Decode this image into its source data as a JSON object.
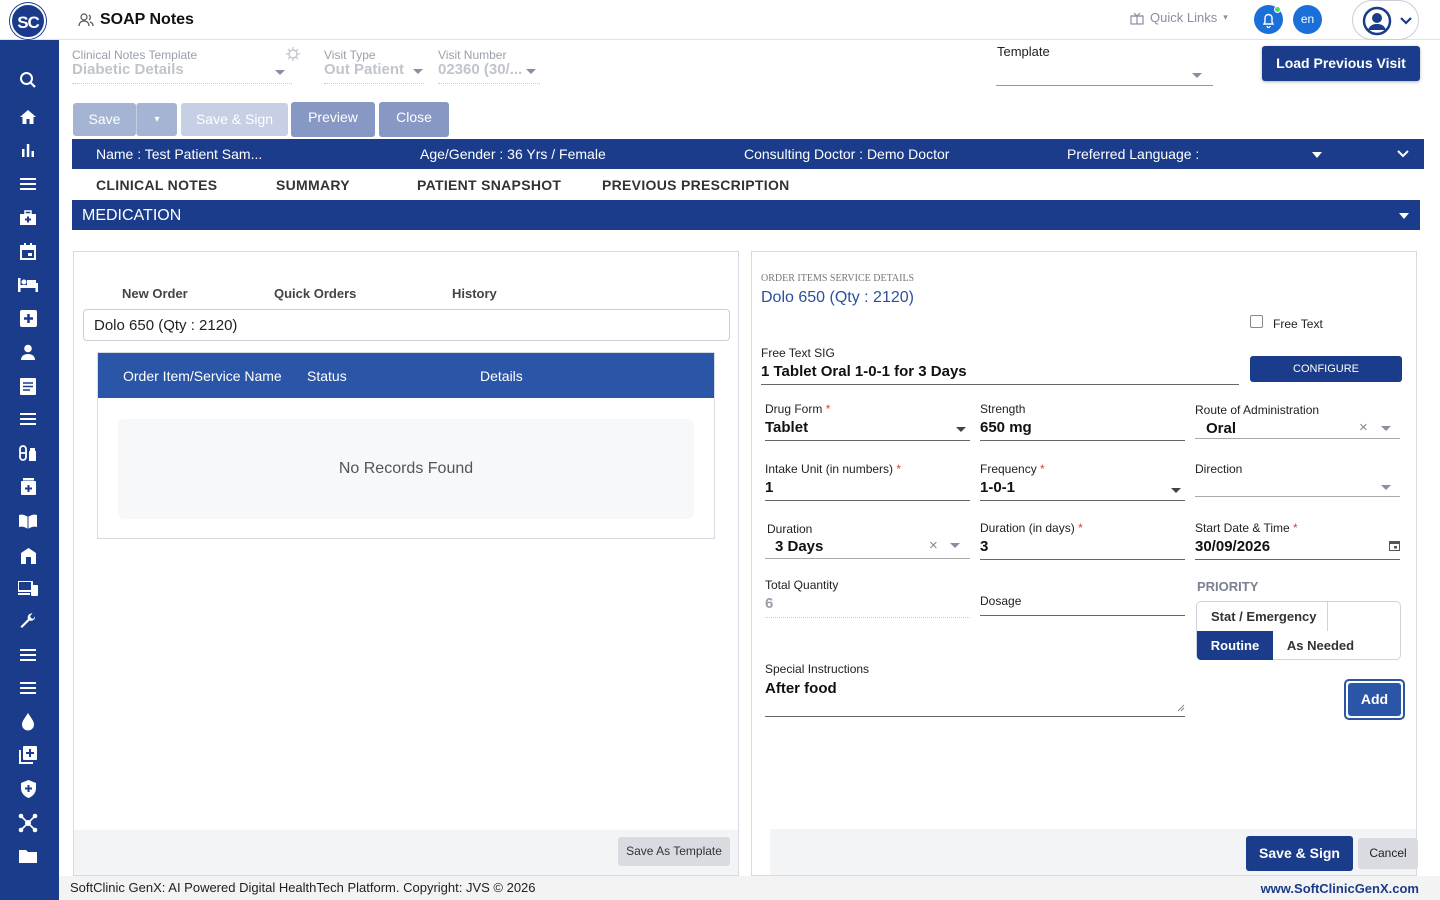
{
  "app": {
    "logo": "SC",
    "title": "SOAP Notes"
  },
  "topbar": {
    "quick_links": "Quick Links",
    "lang": "en"
  },
  "sidebar": {
    "icons": [
      "search-icon",
      "home-icon",
      "bar-chart-icon",
      "menu-icon",
      "clinic-icon",
      "calendar-icon",
      "bed-icon",
      "first-aid-icon",
      "person-icon",
      "document-icon",
      "list-icon",
      "pharmacy-icon",
      "medicine-icon",
      "book-icon",
      "building-icon",
      "devices-icon",
      "wrench-icon",
      "list-icon",
      "list-icon",
      "drop-icon",
      "add-box-icon",
      "shield-icon",
      "network-icon",
      "folder-icon"
    ]
  },
  "header": {
    "clinical_template_label": "Clinical Notes Template",
    "clinical_template_value": "Diabetic Details",
    "visit_type_label": "Visit Type",
    "visit_type_value": "Out Patient",
    "visit_number_label": "Visit Number",
    "visit_number_value": "02360 (30/...",
    "template_label": "Template",
    "load_previous": "Load Previous Visit"
  },
  "actions": {
    "save": "Save",
    "save_sign": "Save & Sign",
    "preview": "Preview",
    "close": "Close"
  },
  "patient": {
    "name": "Name :  Test Patient Sam...",
    "age_gender": "Age/Gender :  36 Yrs / Female",
    "doctor": "Consulting Doctor :  Demo Doctor",
    "language": "Preferred Language :"
  },
  "tabs": [
    "CLINICAL NOTES",
    "SUMMARY",
    "PATIENT SNAPSHOT",
    "PREVIOUS PRESCRIPTION"
  ],
  "section_title": "MEDICATION",
  "left_panel": {
    "subtabs": [
      "New Order",
      "Quick Orders",
      "History"
    ],
    "search_value": "Dolo 650   (Qty : 2120)",
    "table_headers": [
      "Order Item/Service Name",
      "Status",
      "Details"
    ],
    "empty_text": "No Records Found",
    "save_template": "Save As Template"
  },
  "right_panel": {
    "caption": "ORDER ITEMS SERVICE DETAILS",
    "item_title": "Dolo 650 (Qty : 2120)",
    "free_text_label": "Free Text",
    "sig_label": "Free Text SIG",
    "sig_value": "1 Tablet Oral 1-0-1  for 3 Days",
    "configure": "CONFIGURE",
    "drug_form_label": "Drug Form",
    "drug_form_value": "Tablet",
    "strength_label": "Strength",
    "strength_value": "650 mg",
    "route_label": "Route of Administration",
    "route_value": "Oral",
    "intake_label": "Intake Unit (in numbers)",
    "intake_value": "1",
    "frequency_label": "Frequency",
    "frequency_value": "1-0-1",
    "direction_label": "Direction",
    "duration_label": "Duration",
    "duration_value": "3 Days",
    "duration_days_label": "Duration (in days)",
    "duration_days_value": "3",
    "start_label": "Start Date & Time",
    "start_value": "30/09/2026",
    "total_qty_label": "Total Quantity",
    "total_qty_value": "6",
    "dosage_label": "Dosage",
    "priority_label": "PRIORITY",
    "priority_options": [
      "Stat / Emergency",
      "Routine",
      "As Needed"
    ],
    "special_label": "Special Instructions",
    "special_value": "After food",
    "add": "Add",
    "save_sign": "Save & Sign",
    "cancel": "Cancel"
  },
  "footer": {
    "copyright": "SoftClinic GenX: AI Powered Digital HealthTech Platform. Copyright: JVS © 2026",
    "site": "www.SoftClinicGenX.com"
  },
  "colors": {
    "brand": "#1b3c8a",
    "accent": "#1a6fd8"
  }
}
